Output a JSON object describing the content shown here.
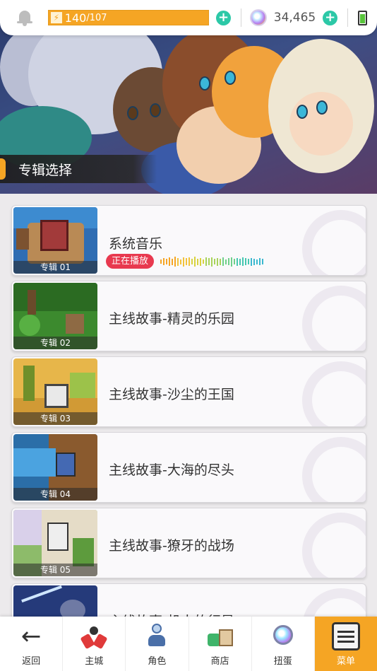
{
  "topbar": {
    "energy_current": "140",
    "energy_max": "/107",
    "energy_fraction": 1.0,
    "gems": "34,465",
    "colors": {
      "energy": "#f5a524",
      "plus": "#2cc8a7"
    }
  },
  "section": {
    "title": "专辑选择"
  },
  "albums": [
    {
      "title": "系统音乐",
      "tag": "专辑 01",
      "playing_label": "正在播放",
      "is_playing": true
    },
    {
      "title": "主线故事-精灵的乐园",
      "tag": "专辑 02"
    },
    {
      "title": "主线故事-沙尘的王国",
      "tag": "专辑 03"
    },
    {
      "title": "主线故事-大海的尽头",
      "tag": "专辑 04"
    },
    {
      "title": "主线故事-獠牙的战场",
      "tag": "专辑 05"
    },
    {
      "title": "主线故事-机人的行星",
      "tag": ""
    }
  ],
  "nav": {
    "back": "返回",
    "town": "主城",
    "character": "角色",
    "shop": "商店",
    "gacha": "扭蛋",
    "menu": "菜单",
    "active": "menu",
    "accent": "#f5a524"
  }
}
